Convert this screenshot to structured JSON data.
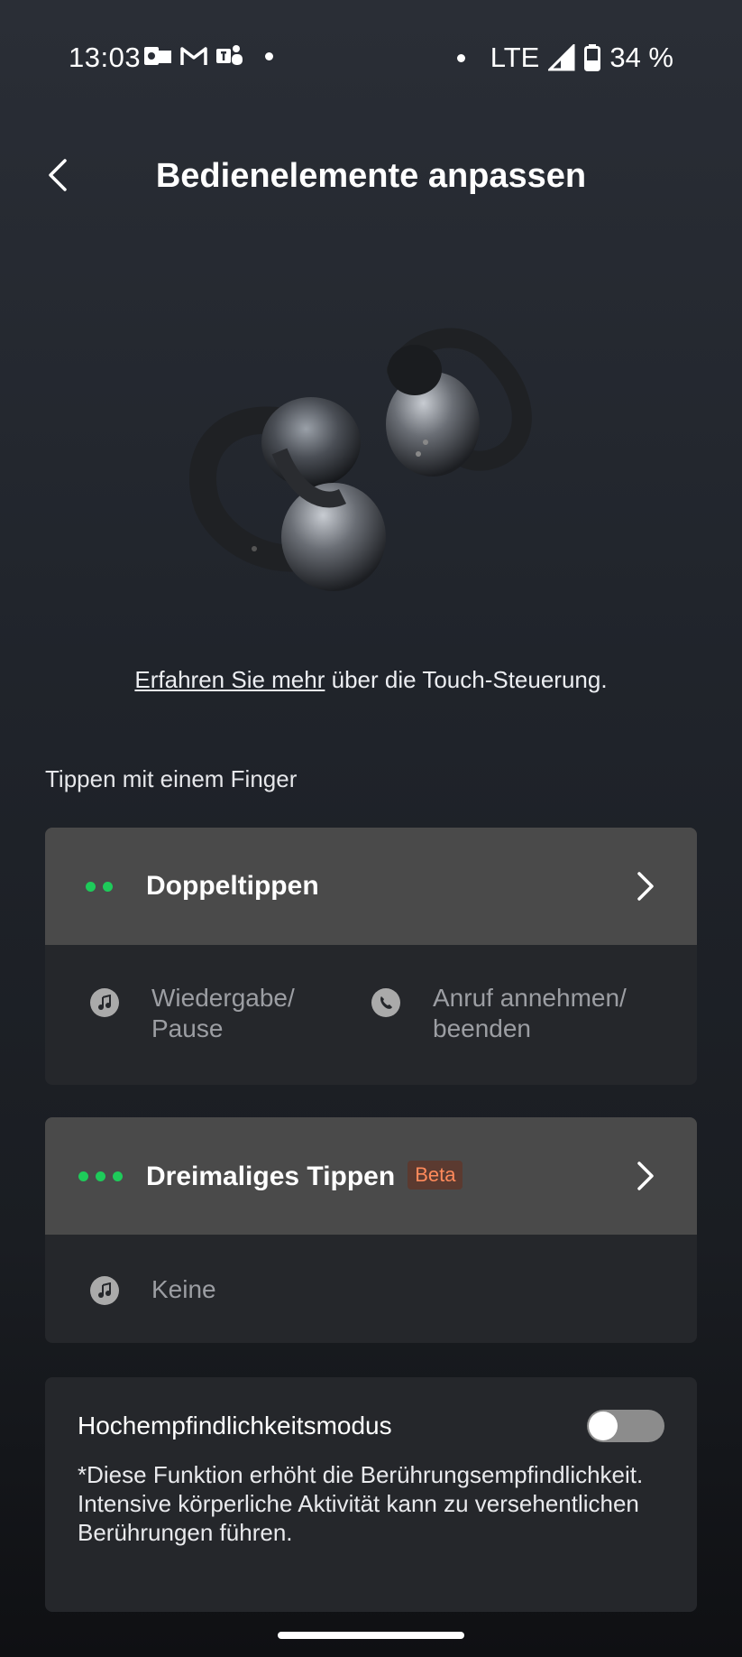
{
  "status_bar": {
    "time": "13:03",
    "network": "LTE",
    "battery": "34 %",
    "notification_icons": [
      "outlook-icon",
      "gmail-icon",
      "teams-icon"
    ]
  },
  "header": {
    "title": "Bedienelemente anpassen"
  },
  "learn_more": {
    "link_text": "Erfahren Sie mehr",
    "suffix": " über die Touch-Steuerung."
  },
  "section_label": "Tippen mit einem Finger",
  "double_tap": {
    "title": "Doppeltippen",
    "options": [
      {
        "label": "Wiedergabe/\nPause",
        "icon": "music-note-icon"
      },
      {
        "label": "Anruf annehmen/\nbeenden",
        "icon": "phone-icon"
      }
    ]
  },
  "triple_tap": {
    "title": "Dreimaliges Tippen",
    "badge": "Beta",
    "options": [
      {
        "label": "Keine",
        "icon": "music-note-icon"
      }
    ]
  },
  "sensitivity": {
    "label": "Hochempfindlichkeitsmodus",
    "enabled": false,
    "description": "*Diese Funktion erhöht die Berührungsempfindlichkeit. Intensive körperliche Aktivität kann zu versehentlichen Berührungen führen."
  },
  "colors": {
    "accent_green": "#1ecb5a",
    "beta_orange": "#ff8a5b"
  }
}
